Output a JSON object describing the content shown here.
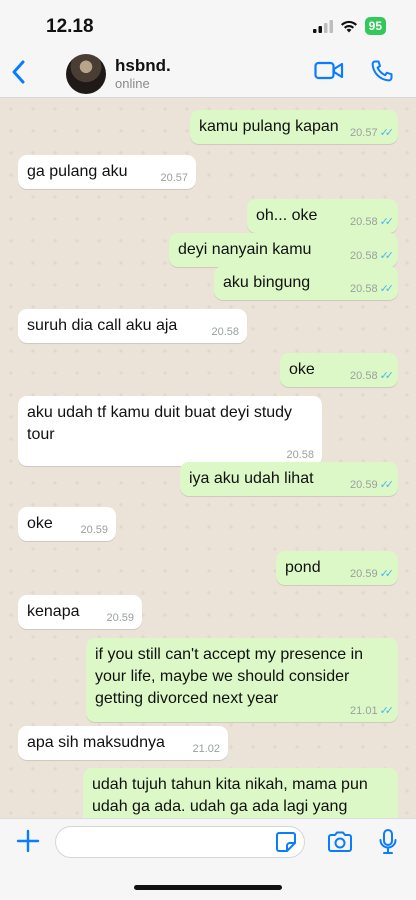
{
  "status": {
    "time": "12.18",
    "battery": "95"
  },
  "contact": {
    "name": "hsbnd.",
    "status": "online"
  },
  "messages": [
    {
      "dir": "out",
      "text": "kamu pulang kapan",
      "time": "20.57",
      "read": true
    },
    {
      "dir": "in",
      "text": "ga pulang aku",
      "time": "20.57"
    },
    {
      "dir": "out",
      "text": "oh... oke",
      "time": "20.58",
      "read": true
    },
    {
      "dir": "out",
      "text": "deyi nanyain kamu",
      "time": "20.58",
      "read": true
    },
    {
      "dir": "out",
      "text": "aku bingung",
      "time": "20.58",
      "read": true
    },
    {
      "dir": "in",
      "text": "suruh dia call aku aja",
      "time": "20.58"
    },
    {
      "dir": "out",
      "text": "oke",
      "time": "20.58",
      "read": true
    },
    {
      "dir": "in",
      "text": "aku udah tf kamu duit buat deyi study tour",
      "time": "20.58"
    },
    {
      "dir": "out",
      "text": "iya aku udah lihat",
      "time": "20.59",
      "read": true
    },
    {
      "dir": "in",
      "text": "oke",
      "time": "20.59"
    },
    {
      "dir": "out",
      "text": "pond",
      "time": "20.59",
      "read": true
    },
    {
      "dir": "in",
      "text": "kenapa",
      "time": "20.59"
    },
    {
      "dir": "out",
      "text": "if you still can't accept my presence in your life, maybe we should consider getting divorced next year",
      "time": "21.01",
      "read": true
    },
    {
      "dir": "in",
      "text": "apa sih maksudnya",
      "time": "21.02"
    },
    {
      "dir": "out",
      "text": "udah tujuh tahun kita nikah, mama pun udah ga ada. udah ga ada lagi yang",
      "time": "",
      "read": false
    }
  ],
  "composer": {
    "placeholder": ""
  },
  "colors": {
    "accent": "#0a7cff",
    "outgoing": "#dcf8c6",
    "incoming": "#ffffff",
    "read_ticks": "#4fb6ec"
  }
}
